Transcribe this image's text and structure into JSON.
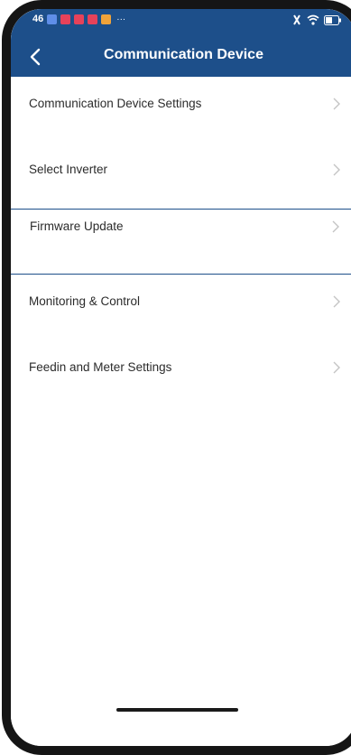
{
  "status_bar": {
    "signal_text": "46",
    "more_indicator": "···",
    "notifications": [
      {
        "icon": "notification-app-icon",
        "color": "#5f8ee8"
      },
      {
        "icon": "notification-app-icon",
        "color": "#e7425a"
      },
      {
        "icon": "notification-app-icon",
        "color": "#e7425a"
      },
      {
        "icon": "notification-app-icon",
        "color": "#e7425a"
      },
      {
        "icon": "notification-app-icon",
        "color": "#f0a33a"
      }
    ],
    "right_icons": [
      "mute-icon",
      "wifi-icon",
      "battery-icon"
    ]
  },
  "header": {
    "title": "Communication Device",
    "back_icon": "chevron-left-icon",
    "background": "#1d4f8a"
  },
  "menu": {
    "items": [
      {
        "label": "Communication Device Settings",
        "icon": "chevron-right-icon",
        "selected": false
      },
      {
        "label": "Select Inverter",
        "icon": "chevron-right-icon",
        "selected": false
      },
      {
        "label": "Firmware Update",
        "icon": "chevron-right-icon",
        "selected": true
      },
      {
        "label": "Monitoring & Control",
        "icon": "chevron-right-icon",
        "selected": false
      },
      {
        "label": "Feedin and Meter Settings",
        "icon": "chevron-right-icon",
        "selected": false
      }
    ]
  },
  "colors": {
    "accent": "#1d4f8a",
    "text": "#2b2b2b",
    "chevron": "#c4c4c4"
  }
}
